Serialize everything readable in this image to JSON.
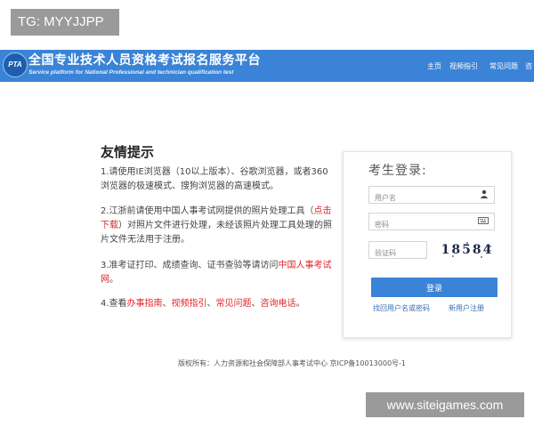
{
  "watermark_top": "TG: MYYJJPP",
  "watermark_bottom": "www.siteigames.com",
  "header": {
    "logo_text": "PTA",
    "title": "全国专业技术人员资格考试报名服务平台",
    "subtitle": "Service platform for National Professional and technician qualification test",
    "nav": [
      "主页",
      "视频指引",
      "常见问题",
      "咨"
    ]
  },
  "tips": {
    "title": "友情提示",
    "item1": "1.请使用IE浏览器（10以上版本）、谷歌浏览器，或者360浏览器的极速模式、搜狗浏览器的高速模式。",
    "item2_before": "2.江浙前请使用中国人事考试网提供的照片处理工具（",
    "item2_link": "点击下载",
    "item2_after": "）对照片文件进行处理，未经该照片处理工具处理的照片文件无法用于注册。",
    "item3_before": "3.准考证打印、成绩查询、证书查验等请访问",
    "item3_link": "中国人事考试网",
    "item3_after": "。",
    "item4_before": "4.查看",
    "item4_links": [
      "办事指南",
      "视频指引",
      "常见问题",
      "咨询电话"
    ],
    "item4_after": "。"
  },
  "login": {
    "title": "考生登录:",
    "username_placeholder": "用户名",
    "password_placeholder": "密码",
    "captcha_placeholder": "验证码",
    "captcha_value": "18584",
    "login_button": "登录",
    "forgot_link": "找回用户名或密码",
    "register_link": "新用户注册"
  },
  "footer": "版权所有：人力资源和社会保障部人事考试中心 京ICP备10013000号-1"
}
